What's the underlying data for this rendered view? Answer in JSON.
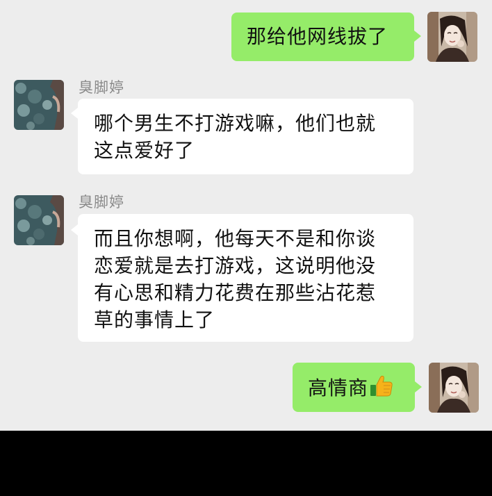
{
  "messages": [
    {
      "side": "self",
      "text": "那给他网线拔了"
    },
    {
      "side": "other",
      "sender": "臭脚婷",
      "text": "哪个男生不打游戏嘛，他们也就这点爱好了",
      "lines": [
        "哪个男生不打游戏嘛，他们也就",
        "这点爱好了"
      ]
    },
    {
      "side": "other",
      "sender": "臭脚婷",
      "text": "而且你想啊，他每天不是和你谈恋爱就是去打游戏，这说明他没有心思和精力花费在那些沾花惹草的事情上了",
      "lines": [
        "而且你想啊，他每天不是和你谈",
        "恋爱就是去打游戏，这说明他没",
        "有心思和精力花费在那些沾花惹",
        "草的事情上了"
      ]
    },
    {
      "side": "self",
      "text": "高情商",
      "emoji": "thumbs-up-icon"
    }
  ],
  "colors": {
    "chat_background": "#ededed",
    "self_bubble": "#95ec69",
    "other_bubble": "#ffffff",
    "sender_name": "#8a8a8a"
  }
}
